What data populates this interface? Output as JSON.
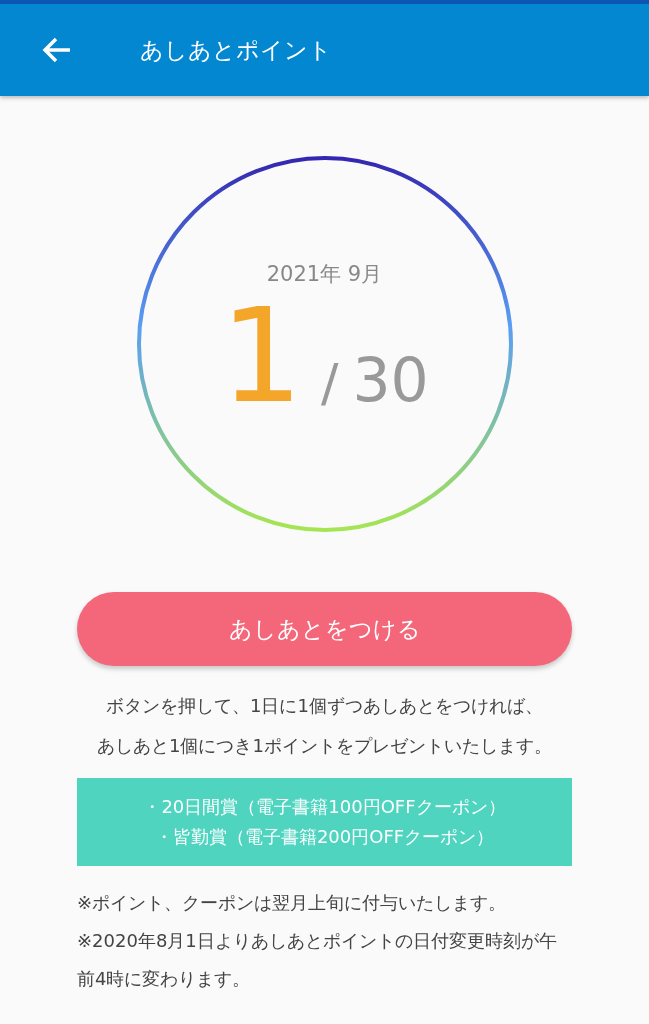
{
  "app_bar": {
    "title": "あしあとポイント"
  },
  "counter": {
    "month": "2021年 9月",
    "count": "1",
    "separator": "/",
    "total": "30"
  },
  "action_button": {
    "label": "あしあとをつける"
  },
  "description": {
    "lines": [
      "ボタンを押して、1日に1個ずつあしあとをつければ、",
      "あしあと1個につき1ポイントをプレゼントいたします。"
    ]
  },
  "prizes": [
    "・20日間賞（電子書籍100円OFFクーポン）",
    "・皆勤賞（電子書籍200円OFFクーポン）"
  ],
  "notes": [
    "※ポイント、クーポンは翌月上旬に付与いたします。",
    "※2020年8月1日よりあしあとポイントの日付変更時刻が午前4時に変わります。"
  ]
}
